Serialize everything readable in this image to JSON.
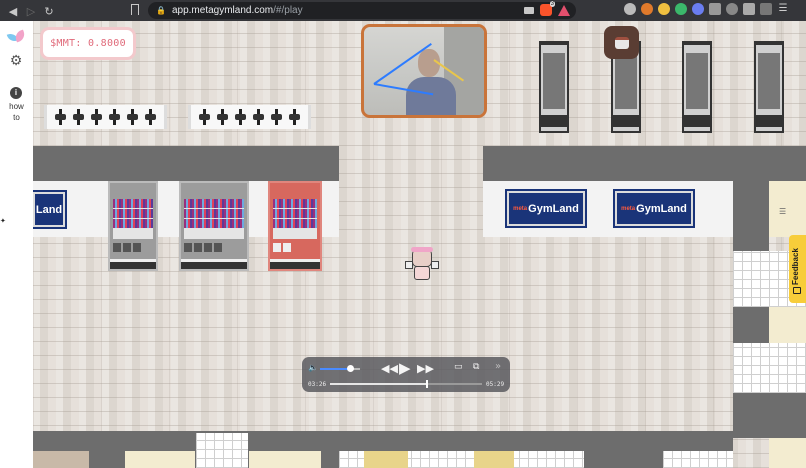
{
  "browser": {
    "url_host": "app.metagymland.com",
    "url_path": "/#/play",
    "brave_count": "3"
  },
  "sidebar": {
    "howto_label_line1": "how",
    "howto_label_line2": "to"
  },
  "hud": {
    "mmt_balance": "$MMT: 0.8000"
  },
  "banners": {
    "left_partial": "Land",
    "banner_meta": "meta",
    "banner_brand": "GymLand"
  },
  "media": {
    "current_time": "03:26",
    "total_time": "05:29",
    "volume_level": 0.75,
    "progress": 0.63
  },
  "feedback": {
    "label": "Feedback"
  },
  "colors": {
    "accent_pink": "#e06a7a",
    "brand_navy": "#1a3479",
    "feedback_yellow": "#f7cd3a"
  }
}
